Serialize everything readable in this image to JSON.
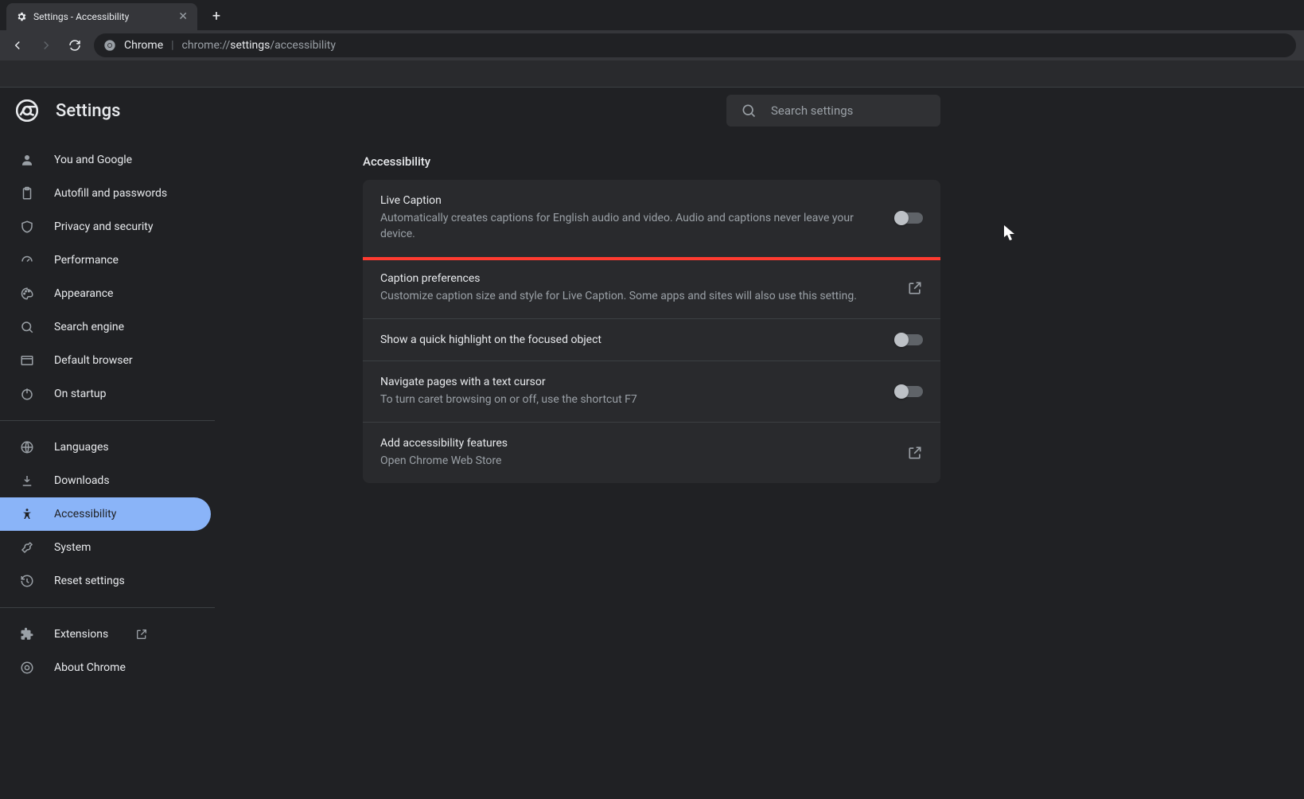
{
  "browser": {
    "tab_title": "Settings - Accessibility",
    "omnibox_prefix": "Chrome",
    "omnibox_url_pre": "chrome://",
    "omnibox_url_bold": "settings",
    "omnibox_url_post": "/accessibility"
  },
  "header": {
    "title": "Settings",
    "search_placeholder": "Search settings"
  },
  "sidebar": {
    "group1": [
      {
        "icon": "person",
        "label": "You and Google"
      },
      {
        "icon": "clipboard",
        "label": "Autofill and passwords"
      },
      {
        "icon": "shield",
        "label": "Privacy and security"
      },
      {
        "icon": "speed",
        "label": "Performance"
      },
      {
        "icon": "palette",
        "label": "Appearance"
      },
      {
        "icon": "search",
        "label": "Search engine"
      },
      {
        "icon": "browser",
        "label": "Default browser"
      },
      {
        "icon": "power",
        "label": "On startup"
      }
    ],
    "group2": [
      {
        "icon": "globe",
        "label": "Languages"
      },
      {
        "icon": "download",
        "label": "Downloads"
      },
      {
        "icon": "accessibility",
        "label": "Accessibility",
        "active": true
      },
      {
        "icon": "wrench",
        "label": "System"
      },
      {
        "icon": "restore",
        "label": "Reset settings"
      }
    ],
    "group3": [
      {
        "icon": "extension",
        "label": "Extensions",
        "launch": true
      },
      {
        "icon": "chrome",
        "label": "About Chrome"
      }
    ]
  },
  "main": {
    "title": "Accessibility",
    "rows": [
      {
        "title": "Live Caption",
        "sub": "Automatically creates captions for English audio and video. Audio and captions never leave your device.",
        "control": "toggle",
        "highlight": true
      },
      {
        "title": "Caption preferences",
        "sub": "Customize caption size and style for Live Caption. Some apps and sites will also use this setting.",
        "control": "launch"
      },
      {
        "title": "Show a quick highlight on the focused object",
        "control": "toggle"
      },
      {
        "title": "Navigate pages with a text cursor",
        "sub": "To turn caret browsing on or off, use the shortcut F7",
        "control": "toggle"
      },
      {
        "title": "Add accessibility features",
        "sub": "Open Chrome Web Store",
        "control": "launch"
      }
    ]
  }
}
